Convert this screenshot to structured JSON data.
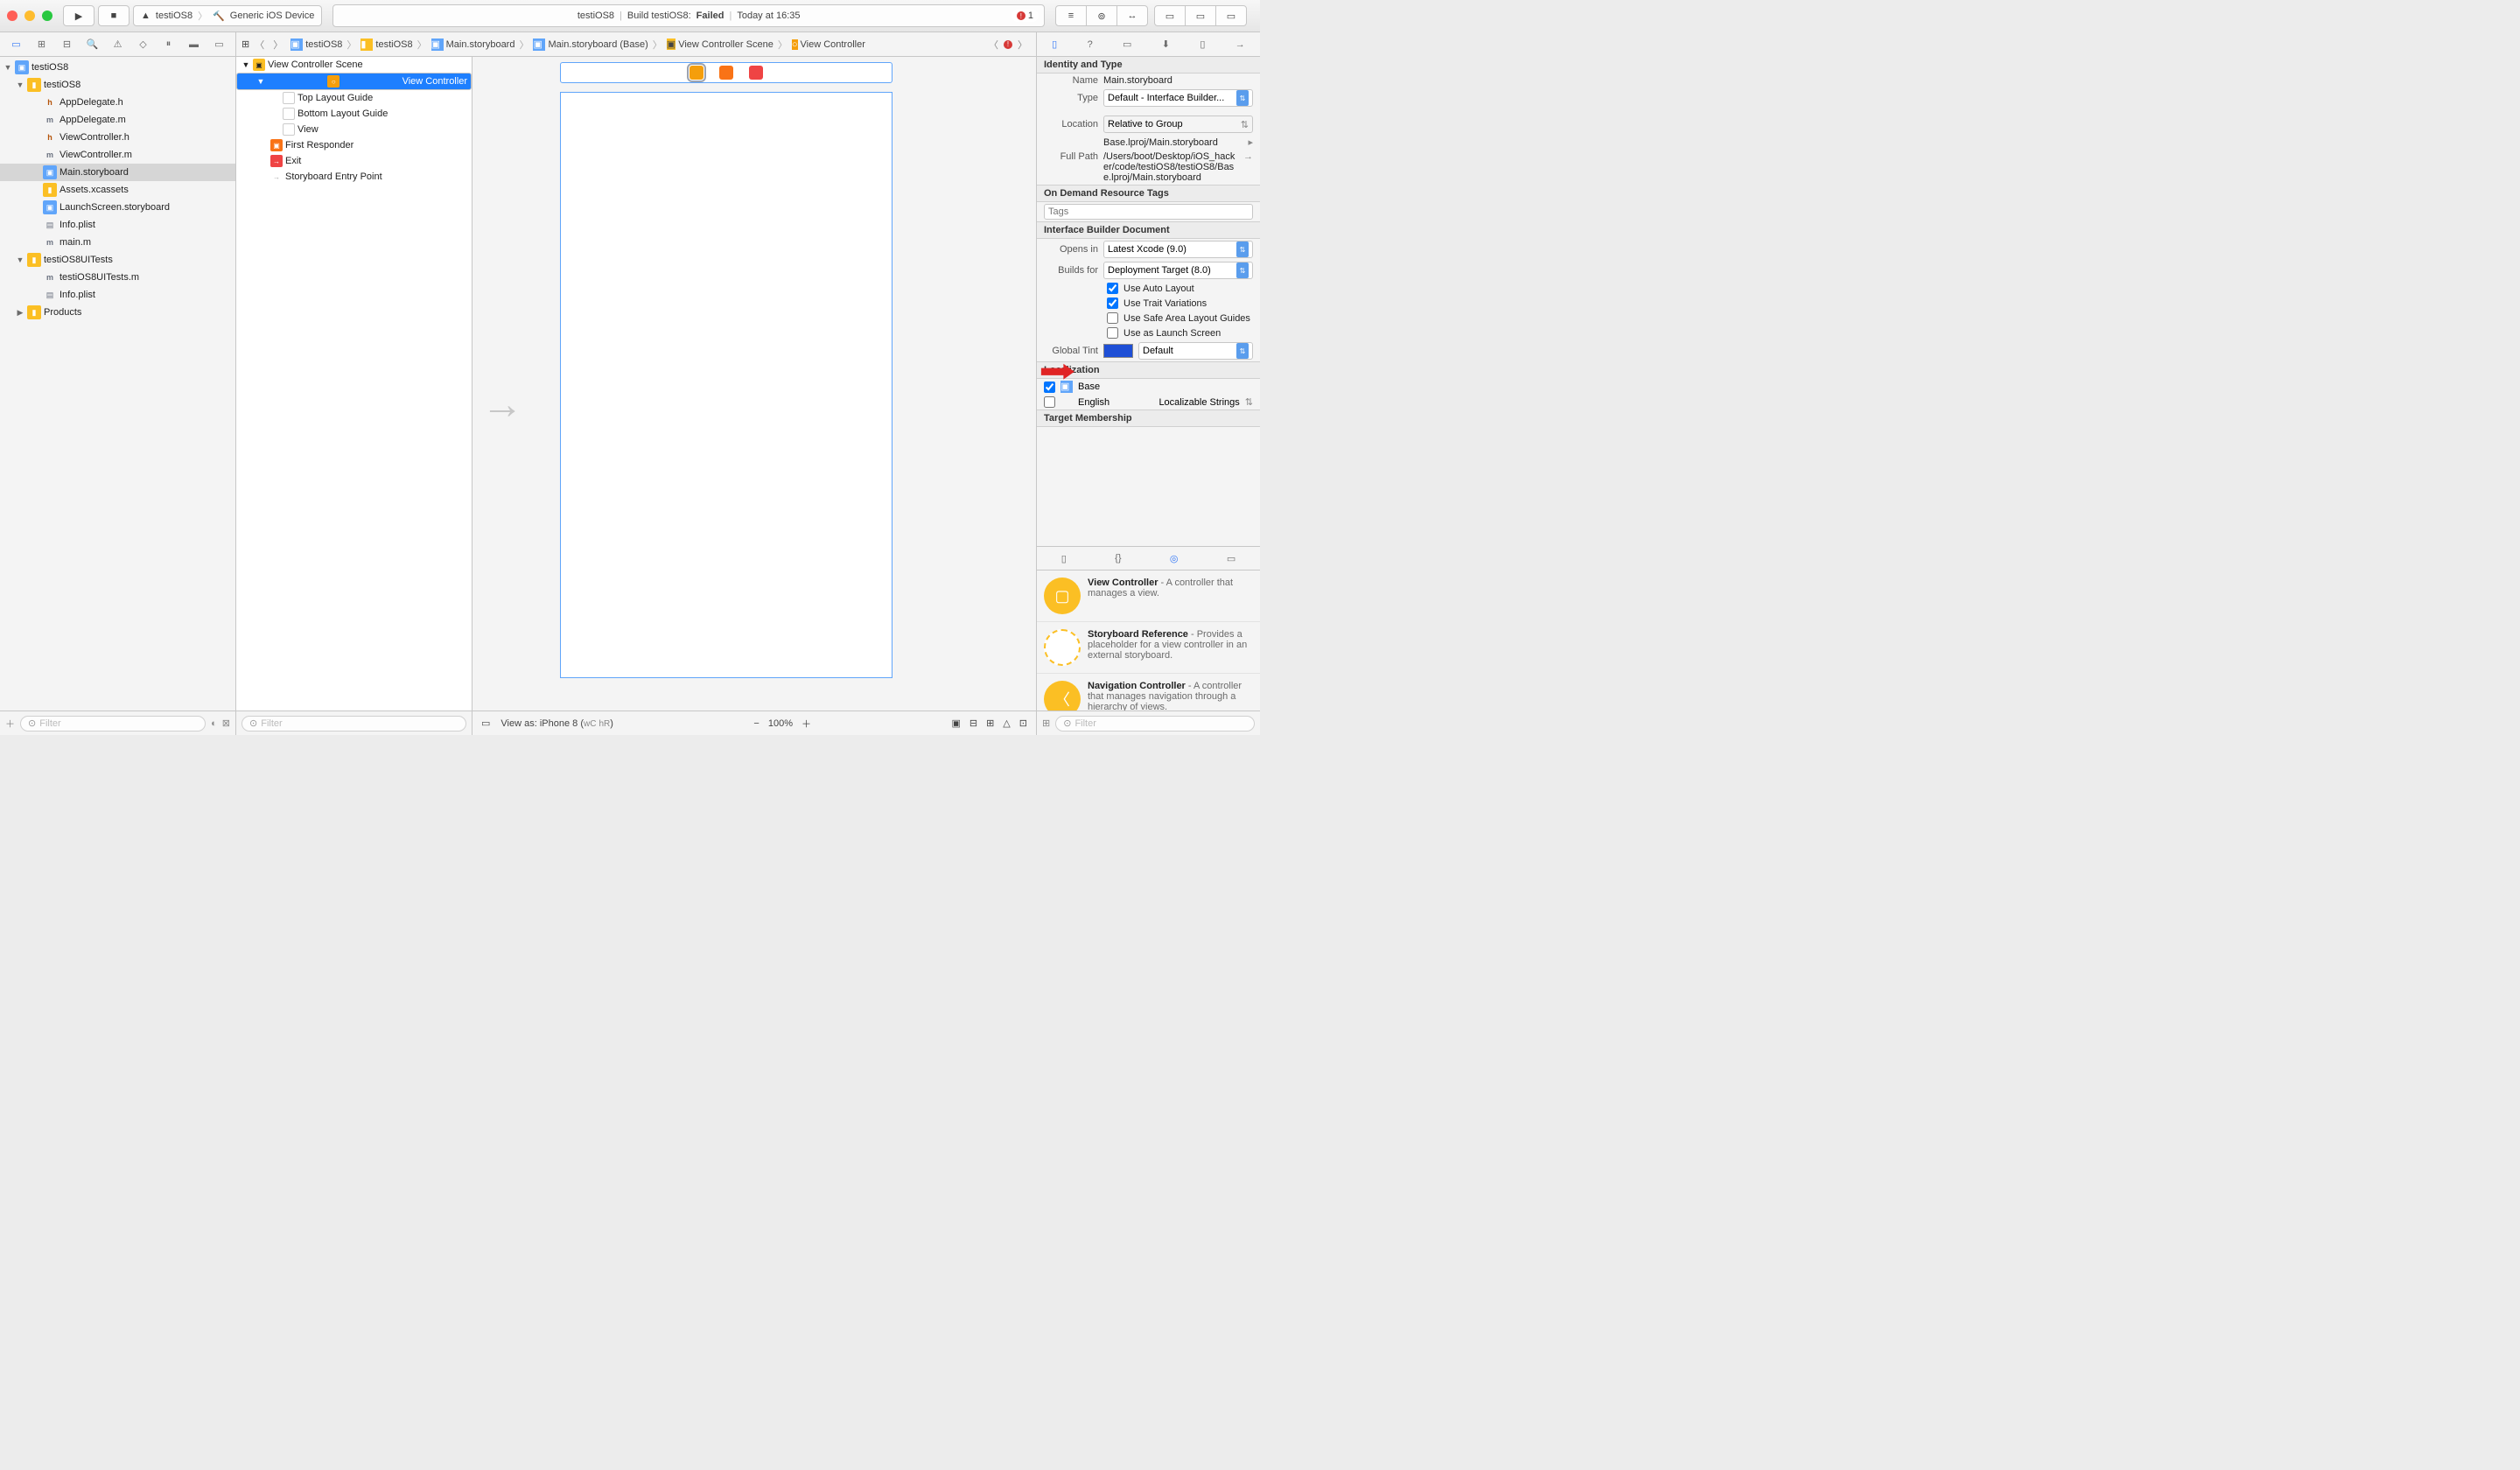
{
  "titlebar": {
    "scheme_target": "testiOS8",
    "scheme_device": "Generic iOS Device",
    "status_project": "testiOS8",
    "status_action": "Build testiOS8:",
    "status_result": "Failed",
    "status_time": "Today at 16:35",
    "error_count": "1"
  },
  "navigator": {
    "project": "testiOS8",
    "group1": "testiOS8",
    "files1": [
      "AppDelegate.h",
      "AppDelegate.m",
      "ViewController.h",
      "ViewController.m",
      "Main.storyboard",
      "Assets.xcassets",
      "LaunchScreen.storyboard",
      "Info.plist",
      "main.m"
    ],
    "group2": "testiOS8UITests",
    "files2": [
      "testiOS8UITests.m",
      "Info.plist"
    ],
    "group3": "Products",
    "filter_placeholder": "Filter"
  },
  "jumpbar": {
    "c0": "testiOS8",
    "c1": "testiOS8",
    "c2": "Main.storyboard",
    "c3": "Main.storyboard (Base)",
    "c4": "View Controller Scene",
    "c5": "View Controller"
  },
  "outline": {
    "scene": "View Controller Scene",
    "vc": "View Controller",
    "top": "Top Layout Guide",
    "bottom": "Bottom Layout Guide",
    "view": "View",
    "first": "First Responder",
    "exit": "Exit",
    "entry": "Storyboard Entry Point",
    "filter_placeholder": "Filter"
  },
  "canvas": {
    "view_as": "View as: iPhone 8 (",
    "wc": "wC",
    "hr": "hR",
    "close": ")",
    "zoom": "100%"
  },
  "inspector": {
    "sec_identity": "Identity and Type",
    "name_label": "Name",
    "name_val": "Main.storyboard",
    "type_label": "Type",
    "type_val": "Default - Interface Builder...",
    "loc_label": "Location",
    "loc_val": "Relative to Group",
    "loc_path": "Base.lproj/Main.storyboard",
    "fullpath_label": "Full Path",
    "fullpath_val": "/Users/boot/Desktop/iOS_hacker/code/testiOS8/testiOS8/Base.lproj/Main.storyboard",
    "sec_ondemand": "On Demand Resource Tags",
    "tags_placeholder": "Tags",
    "sec_ibd": "Interface Builder Document",
    "opens_label": "Opens in",
    "opens_val": "Latest Xcode (9.0)",
    "builds_label": "Builds for",
    "builds_val": "Deployment Target (8.0)",
    "chk_autolayout": "Use Auto Layout",
    "chk_trait": "Use Trait Variations",
    "chk_safearea": "Use Safe Area Layout Guides",
    "chk_launch": "Use as Launch Screen",
    "tint_label": "Global Tint",
    "tint_val": "Default",
    "sec_loc": "Localization",
    "loc_base": "Base",
    "loc_en": "English",
    "loc_en_type": "Localizable Strings",
    "sec_target": "Target Membership",
    "lib": [
      {
        "t": "View Controller",
        "d": " - A controller that manages a view."
      },
      {
        "t": "Storyboard Reference",
        "d": " - Provides a placeholder for a view controller in an external storyboard."
      },
      {
        "t": "Navigation Controller",
        "d": " - A controller that manages navigation through a hierarchy of views."
      }
    ],
    "lib_filter": "Filter"
  }
}
